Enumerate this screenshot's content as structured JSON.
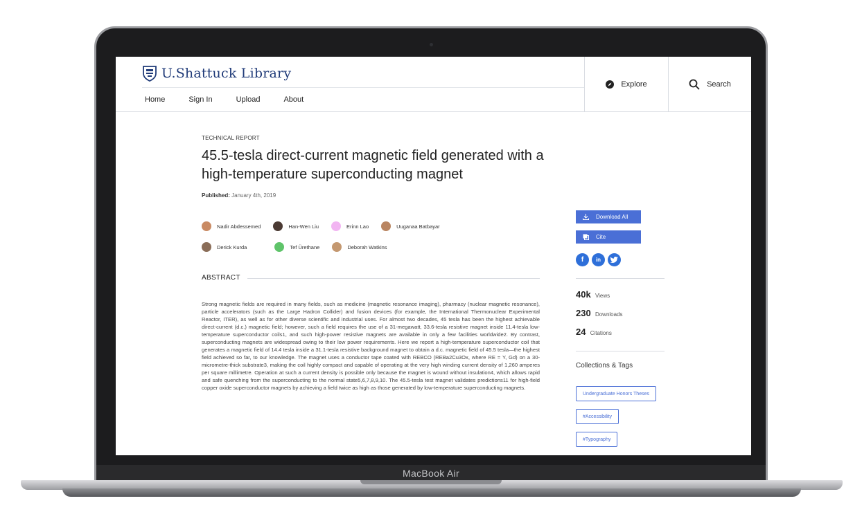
{
  "device": {
    "label": "MacBook Air"
  },
  "header": {
    "brand": "U.Shattuck Library",
    "nav": [
      "Home",
      "Sign In",
      "Upload",
      "About"
    ],
    "explore_label": "Explore",
    "search_label": "Search"
  },
  "article": {
    "eyebrow": "TECHNICAL REPORT",
    "title": "45.5-tesla direct-current magnetic field generated with a high-temperature superconducting magnet",
    "published_label": "Published:",
    "published_date": "January 4th, 2019",
    "authors": [
      {
        "name": "Nadir Abdessemed",
        "avatar_color": "#c98a63"
      },
      {
        "name": "Han-Wen Liu",
        "avatar_color": "#4b3a33"
      },
      {
        "name": "Erinn Lao",
        "avatar_color": "#f2b5f2"
      },
      {
        "name": "Uuganaa Batbayar",
        "avatar_color": "#b98561"
      },
      {
        "name": "Derick Kurda",
        "avatar_color": "#8a6d58"
      },
      {
        "name": "Tef Ürethane",
        "avatar_color": "#5fc46a"
      },
      {
        "name": "Deborah Watkins",
        "avatar_color": "#c49870"
      }
    ],
    "abstract_heading": "ABSTRACT",
    "abstract": "Strong magnetic fields are required in many fields, such as medicine (magnetic resonance imaging), pharmacy (nuclear magnetic resonance), particle accelerators (such as the Large Hadron Collider) and fusion devices (for example, the International Thermonuclear Experimental Reactor, ITER), as well as for other diverse scientific and industrial uses. For almost two decades, 45 tesla has been the highest achievable direct-current (d.c.) magnetic field; however, such a field requires the use of a 31-megawatt, 33.6-tesla resistive magnet inside 11.4-tesla low-temperature superconductor coils1, and such high-power resistive magnets are available in only a few facilities worldwide2. By contrast, superconducting magnets are widespread owing to their low power requirements. Here we report a high-temperature superconductor coil that generates a magnetic field of 14.4 tesla inside a 31.1-tesla resistive background magnet to obtain a d.c. magnetic field of 45.5 tesla—the highest field achieved so far, to our knowledge. The magnet uses a conductor tape coated with REBCO (REBa2Cu3Ox, where RE = Y, Gd) on a 30-micrometre-thick substrate3, making the coil highly compact and capable of operating at the very high winding current density of 1,260 amperes per square millimetre. Operation at such a current density is possible only because the magnet is wound without insulation4, which allows rapid and safe quenching from the superconducting to the normal state5,6,7,8,9,10. The 45.5-tesla test magnet validates predictions11 for high-field copper oxide superconductor magnets by achieving a field twice as high as those generated by low-temperature superconducting magnets."
  },
  "sidebar": {
    "download_label": "Download All",
    "cite_label": "Cite",
    "socials": [
      "f",
      "in",
      "t"
    ],
    "stats": [
      {
        "value": "40k",
        "label": "Views"
      },
      {
        "value": "230",
        "label": "Downloads"
      },
      {
        "value": "24",
        "label": "Citations"
      }
    ],
    "collections_heading": "Collections & Tags",
    "tags": [
      "Undergraduate Honors Theses",
      "#Accessibility",
      "#Typography"
    ]
  },
  "colors": {
    "accent": "#4a6fd6",
    "brand": "#1f3a78",
    "social": "#2e6fd9"
  }
}
